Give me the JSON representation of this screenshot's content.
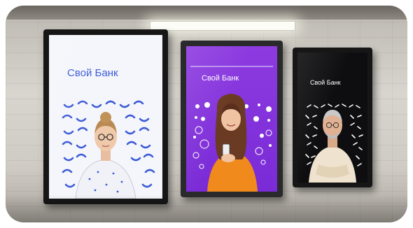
{
  "scene": {
    "posters": [
      {
        "brand": "Свой Банк",
        "background": "#f4f6fb",
        "brand_color": "#3d5bd6",
        "pattern_color": "#3d5bd6"
      },
      {
        "brand": "Свой Банк",
        "background": "#8d3be0",
        "brand_color": "#ffffff",
        "pattern_color": "#ffffff"
      },
      {
        "brand": "Свой Банк",
        "background": "#0e0e10",
        "brand_color": "#ffffff",
        "pattern_color": "#ffffff"
      }
    ]
  }
}
